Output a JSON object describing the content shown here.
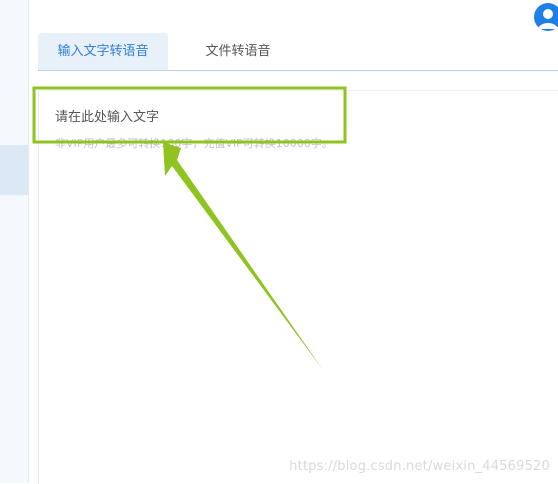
{
  "tabs": [
    {
      "label": "输入文字转语音",
      "active": true
    },
    {
      "label": "文件转语音",
      "active": false
    }
  ],
  "editor": {
    "placeholder": "请在此处输入文字",
    "hint": "非VIP用户最多可转换100字，充值VIP可转换10000字。"
  },
  "watermark": "https://blog.csdn.net/weixin_44569520",
  "colors": {
    "accent": "#2f7fd8",
    "annotation": "#8fc31f",
    "avatar": "#1e7fe6"
  },
  "icons": {
    "avatar": "user-icon"
  }
}
